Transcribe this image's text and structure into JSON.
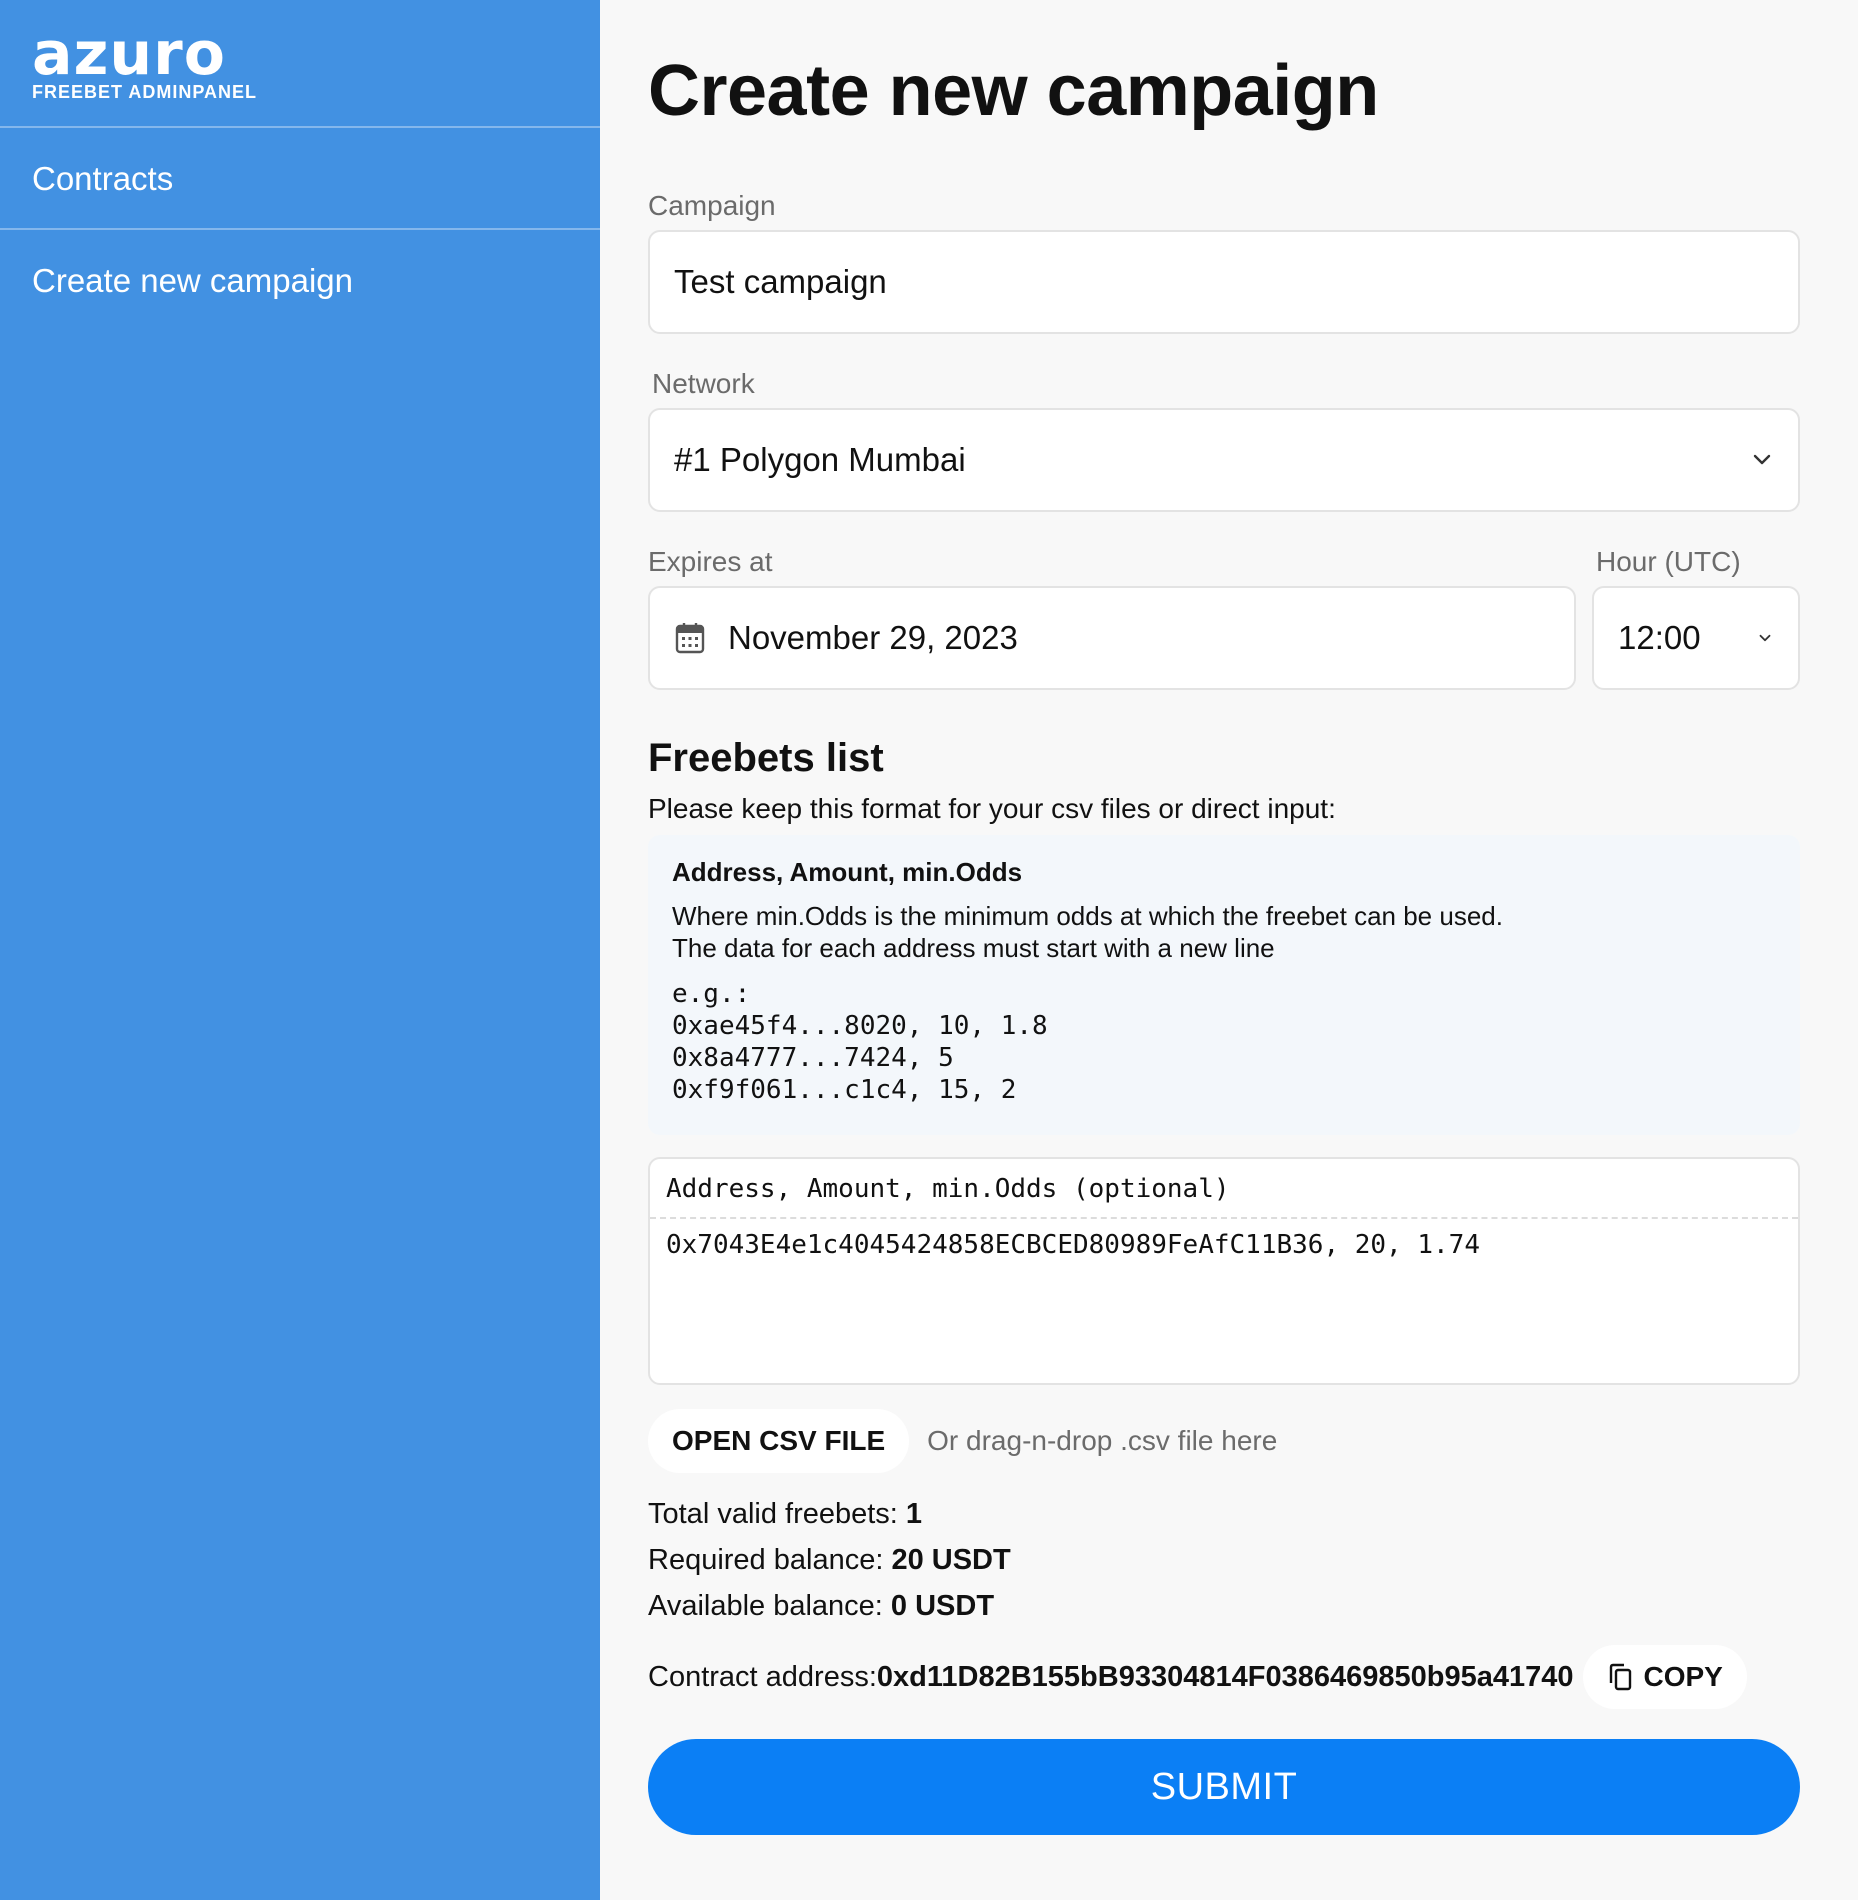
{
  "logo": {
    "word": "azuro",
    "subtitle": "FREEBET ADMINPANEL"
  },
  "sidebar": {
    "items": [
      {
        "label": "Contracts"
      },
      {
        "label": "Create new campaign"
      }
    ]
  },
  "page": {
    "title": "Create new campaign"
  },
  "form": {
    "campaign": {
      "label": "Campaign",
      "value": "Test campaign"
    },
    "network": {
      "label": "Network",
      "value": "#1 Polygon Mumbai"
    },
    "expires": {
      "label": "Expires at",
      "value": "November 29, 2023"
    },
    "hour": {
      "label": "Hour (UTC)",
      "value": "12:00"
    }
  },
  "freebets": {
    "title": "Freebets list",
    "help": "Please keep this format for your csv files or direct input:",
    "format_head": "Address, Amount, min.Odds",
    "format_line1": "Where min.Odds is the minimum odds at which the freebet can be used.",
    "format_line2": "The data for each address must start with a new line",
    "example": "e.g.:\n0xae45f4...8020, 10, 1.8\n0x8a4777...7424, 5\n0xf9f061...c1c4, 15, 2",
    "textarea_header": "Address, Amount, min.Odds (optional)",
    "textarea_value": "0x7043E4e1c4045424858ECBCED80989FeAfC11B36, 20, 1.74"
  },
  "csv": {
    "button": "OPEN CSV FILE",
    "hint": "Or drag-n-drop .csv file here"
  },
  "stats": {
    "total_label": "Total valid freebets: ",
    "total_value": "1",
    "required_label": "Required balance: ",
    "required_value": "20 USDT",
    "available_label": "Available balance: ",
    "available_value": "0 USDT",
    "contract_label": "Contract address: ",
    "contract_value": "0xd11D82B155bB93304814F0386469850b95a41740",
    "copy_label": "COPY"
  },
  "submit": {
    "label": "SUBMIT"
  },
  "colors": {
    "sidebar": "#4291e2",
    "submit": "#0b7ff5",
    "background": "#f8f8f8"
  }
}
